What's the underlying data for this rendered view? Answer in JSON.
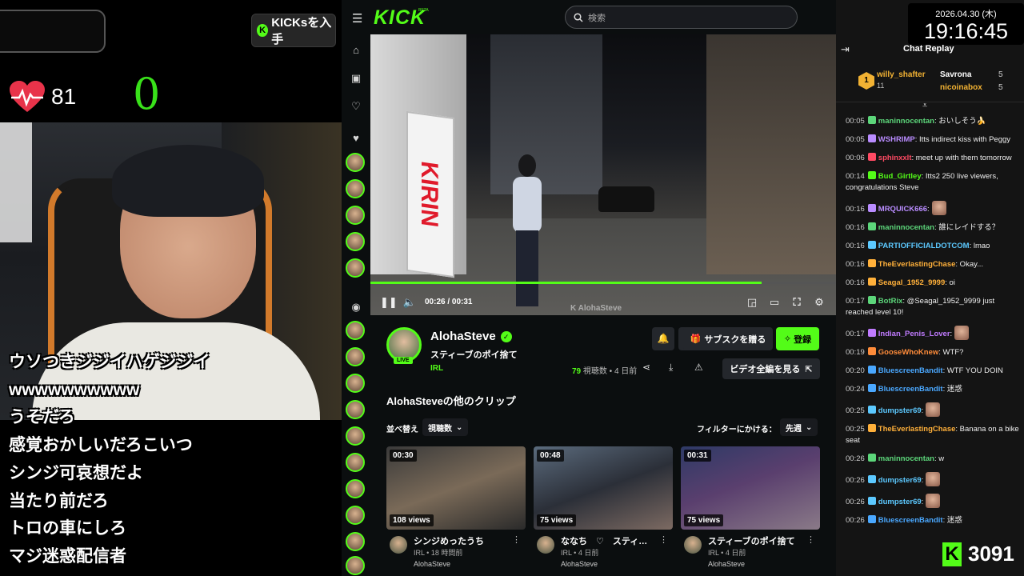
{
  "left": {
    "kicks_button": "KICKsを入手",
    "heart_rate": "81",
    "counter": "0",
    "overlay_chat": [
      "ウソつきジジイハゲジジイ",
      "wwwwwwwwww",
      "うそだろ",
      "感覚おかしいだろこいつ",
      "シンジ可哀想だよ",
      "当たり前だろ",
      "トロの車にしろ",
      "マジ迷惑配信者"
    ]
  },
  "kick": {
    "logo": "KICK",
    "beta": "BETA",
    "search_placeholder": "検索",
    "player": {
      "time": "00:26 / 00:31",
      "progress": 0.84,
      "watermark": "AlohaSteve",
      "sign_text": "KIRIN"
    },
    "channel": {
      "name": "AlohaSteve",
      "clip_title": "スティーブのポイ捨て",
      "category": "IRL",
      "live": "LIVE",
      "gift_label": "サブスクを贈る",
      "subscribe_label": "登録",
      "views_count": "79",
      "views_label": "視聴数 • 4 日前",
      "full_video_label": "ビデオ全編を見る"
    },
    "more_clips_title": "AlohaSteveの他のクリップ",
    "sort_label": "並べ替え",
    "sort_value": "視聴数",
    "filter_label": "フィルターにかける：",
    "filter_value": "先週",
    "clips": [
      {
        "duration": "00:30",
        "views": "108 views",
        "title": "シンジめったうち",
        "sub": "IRL • 18 時間前",
        "channel": "AlohaSteve"
      },
      {
        "duration": "00:48",
        "views": "75 views",
        "title": "ななち　♡　スティ…",
        "sub": "IRL • 4 日前",
        "channel": "AlohaSteve"
      },
      {
        "duration": "00:31",
        "views": "75 views",
        "title": "スティーブのポイ捨て",
        "sub": "IRL • 4 日前",
        "channel": "AlohaSteve"
      }
    ]
  },
  "right": {
    "date": "2026.04.30 (木)",
    "time": "19:16:45",
    "title": "Chat Replay",
    "gifters": {
      "top": {
        "rank": "1",
        "name": "willy_shafter",
        "count": "11"
      },
      "second": {
        "name": "Savrona",
        "count": "5"
      },
      "third": {
        "name": "nicoinabox",
        "count": "5"
      }
    },
    "messages": [
      {
        "ts": "00:05",
        "user": "maninnocentan",
        "color": "#5cd67a",
        "text": "おいしそう🍌"
      },
      {
        "ts": "00:05",
        "user": "WSHRIMP",
        "color": "#b98cff",
        "text": "Itts indirect kiss with Peggy"
      },
      {
        "ts": "00:06",
        "user": "sphinxxlt",
        "color": "#ff4a63",
        "text": "meet up with them tomorrow"
      },
      {
        "ts": "00:14",
        "user": "Bud_Girtley",
        "color": "#53fc18",
        "text": "Itts2 250 live viewers, congratulations Steve"
      },
      {
        "ts": "00:16",
        "user": "MRQUICK666",
        "color": "#b98cff",
        "text": ""
      },
      {
        "ts": "00:16",
        "user": "maninnocentan",
        "color": "#5cd67a",
        "text": "誰にレイドする？"
      },
      {
        "ts": "00:16",
        "user": "PARTIOFFICIALDOTCOM",
        "color": "#5cc9ff",
        "text": "lmao"
      },
      {
        "ts": "00:16",
        "user": "TheEverlastingChase",
        "color": "#ffb03a",
        "text": "Okay..."
      },
      {
        "ts": "00:16",
        "user": "Seagal_1952_9999",
        "color": "#ffb03a",
        "text": "oi"
      },
      {
        "ts": "00:17",
        "user": "BotRix",
        "color": "#5cd67a",
        "text": "@Seagal_1952_9999 just reached level 10!"
      },
      {
        "ts": "00:17",
        "user": "Indian_Penis_Lover",
        "color": "#c07bff",
        "text": ""
      },
      {
        "ts": "00:19",
        "user": "GooseWhoKnew",
        "color": "#ff8c3a",
        "text": "WTF?"
      },
      {
        "ts": "00:20",
        "user": "BluescreenBandit",
        "color": "#4aa8ff",
        "text": "WTF YOU DOIN"
      },
      {
        "ts": "00:24",
        "user": "BluescreenBandit",
        "color": "#4aa8ff",
        "text": "迷惑"
      },
      {
        "ts": "00:25",
        "user": "dumpster69",
        "color": "#5cc9ff",
        "text": ""
      },
      {
        "ts": "00:25",
        "user": "TheEverlastingChase",
        "color": "#ffb03a",
        "text": "Banana on a bike seat"
      },
      {
        "ts": "00:26",
        "user": "maninnocentan",
        "color": "#5cd67a",
        "text": "w"
      },
      {
        "ts": "00:26",
        "user": "dumpster69",
        "color": "#5cc9ff",
        "text": ""
      },
      {
        "ts": "00:26",
        "user": "dumpster69",
        "color": "#5cc9ff",
        "text": ""
      },
      {
        "ts": "00:26",
        "user": "BluescreenBandit",
        "color": "#4aa8ff",
        "text": "迷惑"
      }
    ],
    "kick_count": "3091"
  },
  "colors": {
    "accent": "#53fc18",
    "background": "#0b0e0f"
  },
  "icons": [
    "menu-icon",
    "search-icon",
    "home-icon",
    "browse-icon",
    "heart-icon",
    "play-pause-icon",
    "volume-icon",
    "settings-icon",
    "bell-icon",
    "gift-icon",
    "share-icon",
    "download-icon",
    "report-icon",
    "external-link-icon",
    "chevron-down-icon",
    "chat-collapse-icon",
    "kebab-icon"
  ]
}
